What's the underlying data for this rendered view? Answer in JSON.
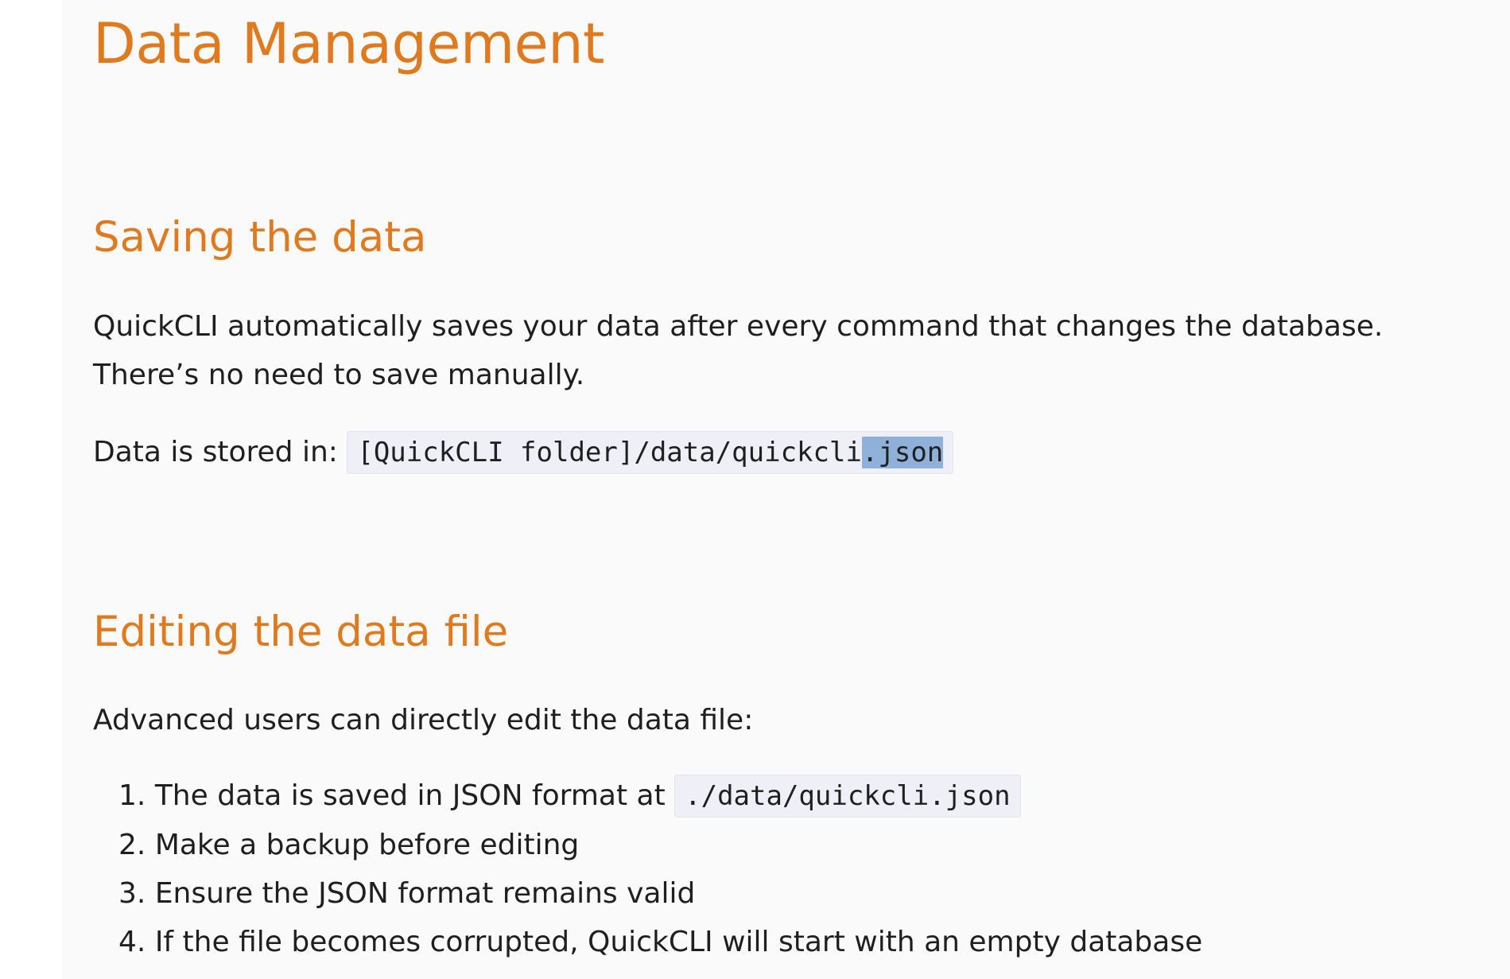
{
  "document": {
    "title": "Data Management",
    "sections": [
      {
        "heading": "Saving the data",
        "paragraph": "QuickCLI automatically saves your data after every command that changes the database. There’s no need to save manually.",
        "stored_label": "Data is stored in:",
        "stored_path_main": "[QuickCLI folder]/data/quickcli",
        "stored_path_selected": ".json"
      },
      {
        "heading": "Editing the data file",
        "intro": "Advanced users can directly edit the data file:",
        "steps": [
          {
            "number": "1.",
            "text": "The data is saved in JSON format at",
            "code": "./data/quickcli.json"
          },
          {
            "number": "2.",
            "text": "Make a backup before editing"
          },
          {
            "number": "3.",
            "text": "Ensure the JSON format remains valid"
          },
          {
            "number": "4.",
            "text": "If the file becomes corrupted, QuickCLI will start with an empty database"
          }
        ]
      }
    ]
  }
}
